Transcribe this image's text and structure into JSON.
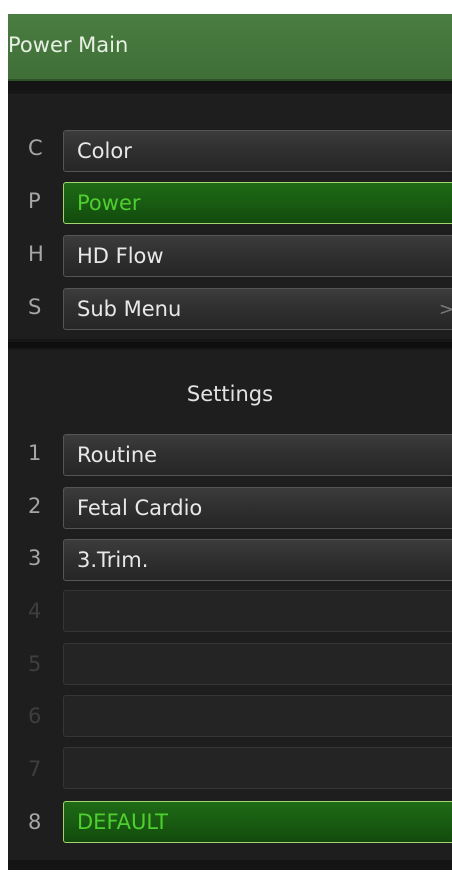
{
  "header": {
    "title": "Power Main"
  },
  "modes": [
    {
      "key": "C",
      "label": "Color",
      "active": false
    },
    {
      "key": "P",
      "label": "Power",
      "active": true
    },
    {
      "key": "H",
      "label": "HD Flow",
      "active": false
    },
    {
      "key": "S",
      "label": "Sub Menu",
      "active": false,
      "chevron": ">"
    }
  ],
  "settings": {
    "title": "Settings",
    "items": [
      {
        "key": "1",
        "label": "Routine",
        "active": false
      },
      {
        "key": "2",
        "label": "Fetal Cardio",
        "active": false
      },
      {
        "key": "3",
        "label": "3.Trim.",
        "active": false
      },
      {
        "key": "4",
        "label": "",
        "active": false
      },
      {
        "key": "5",
        "label": "",
        "active": false
      },
      {
        "key": "6",
        "label": "",
        "active": false
      },
      {
        "key": "7",
        "label": "",
        "active": false
      },
      {
        "key": "8",
        "label": "DEFAULT",
        "active": true
      }
    ]
  },
  "colors": {
    "header_bg": "#447a3c",
    "active_bg": "#1a5e13",
    "active_text": "#4fce2f",
    "active_border": "#a2d66c",
    "panel_bg": "#1e1e1e"
  }
}
